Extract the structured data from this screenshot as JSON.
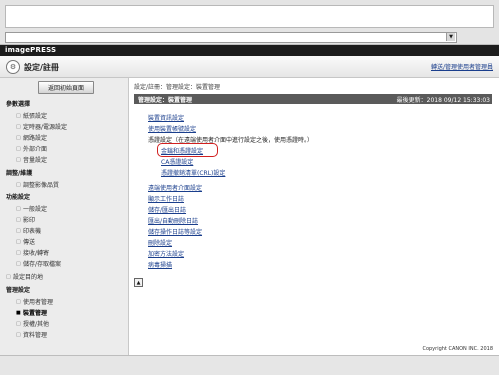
{
  "logo": "imagePRESS",
  "header": {
    "title": "設定/註冊",
    "manage_link": "轉送/管理使用者管理員"
  },
  "address_bar": {
    "value": ""
  },
  "sidebar": {
    "home_button": "返回初始頁面",
    "sections": [
      {
        "heading": "參數選擇",
        "items": [
          "紙張設定",
          "定時器/電源設定",
          "網路設定",
          "外部介面",
          "音量設定"
        ]
      },
      {
        "heading": "調整/維護",
        "items": [
          "調整影像品質"
        ]
      },
      {
        "heading": "功能設定",
        "items": [
          "一般設定",
          "影印",
          "印表機",
          "傳送",
          "接收/轉寄",
          "儲存/存取檔案"
        ]
      },
      {
        "heading": "設定目的地",
        "items": []
      },
      {
        "heading": "管理設定",
        "items": [
          "使用者管理",
          "裝置管理",
          "授權/其他",
          "資料管理"
        ]
      }
    ],
    "selected_item": "裝置管理"
  },
  "main": {
    "breadcrumb": "設定/註冊：管理設定：裝置管理",
    "section_title": "管理設定：裝置管理",
    "last_update": "最後更新：2018 09/12 15:33:03",
    "links": {
      "device_info": "裝置資訊設定",
      "restrict_account": "使用裝置帳號設定",
      "cert_settings": "憑證設定",
      "cert_note": "（在遠端使用者介面中進行設定之後，使用憑證時。）",
      "key_cert": "金鑰和憑證設定",
      "ca_cert": "CA憑證設定",
      "crl": "憑證撤銷清單(CRL)設定",
      "remote_ui": "遠端使用者介面設定",
      "job_log": "顯示工作日誌",
      "save_log": "儲存/匯出日誌",
      "audit_log": "匯出/自動刪除日誌",
      "ops_log": "儲存操作日誌等設定",
      "rb_settings": "刪除設定",
      "encryption": "加密方法設定",
      "virus": "病毒掃描"
    },
    "top_button": "▲",
    "copyright": "Copyright CANON INC. 2018"
  },
  "icons": {
    "settings": "gear-icon",
    "dropdown": "chevron-down-icon",
    "top": "arrow-up-icon"
  }
}
